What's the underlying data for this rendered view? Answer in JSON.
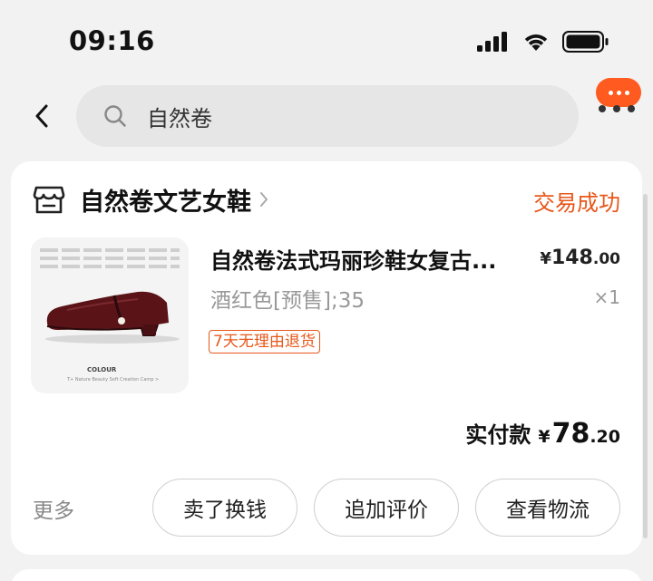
{
  "status_bar": {
    "time": "09:16"
  },
  "search": {
    "query": "自然卷"
  },
  "order": {
    "shop_name": "自然卷文艺女鞋",
    "status": "交易成功",
    "product": {
      "title": "自然卷法式玛丽珍鞋女复古...",
      "price_symbol": "¥",
      "price_int": "148",
      "price_dec": ".00",
      "sku": "酒红色[预售];35",
      "quantity": "×1",
      "tag": "7天无理由退货",
      "image_text": {
        "colour": "COLOUR",
        "caption": "T+ Nature Beauty Soft Creation Camp >"
      }
    },
    "paid": {
      "label": "实付款",
      "symbol": "¥",
      "int": "78",
      "dec": ".20"
    }
  },
  "actions": {
    "more": "更多",
    "buttons": [
      "卖了换钱",
      "追加评价",
      "查看物流"
    ]
  },
  "colors": {
    "accent": "#e8571a",
    "badge": "#ff5a1f"
  }
}
